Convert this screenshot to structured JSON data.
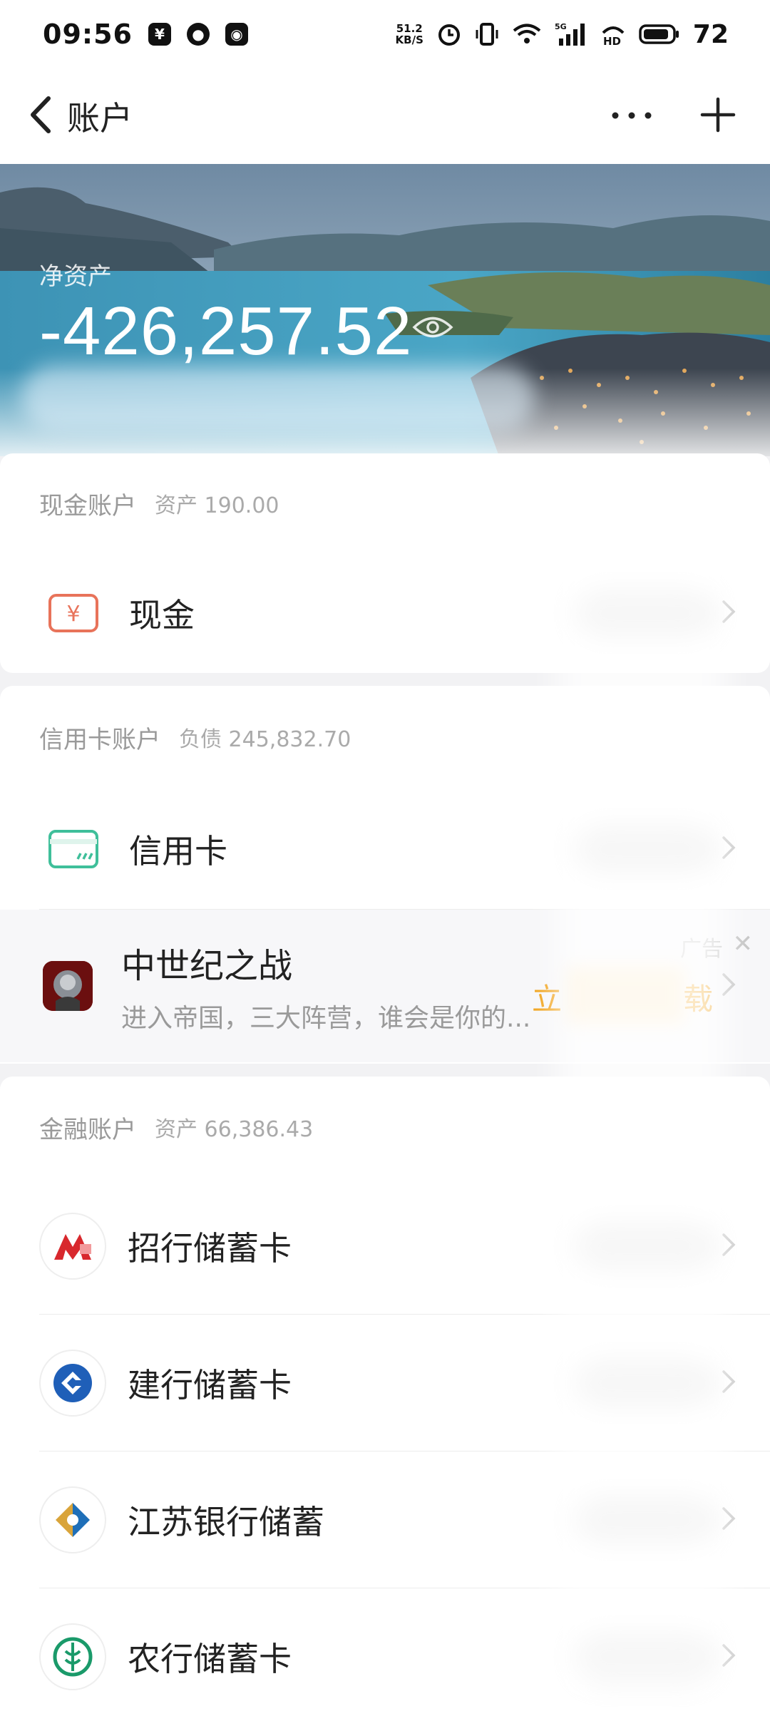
{
  "status_bar": {
    "time": "09:56",
    "net_speed_value": "51.2",
    "net_speed_unit": "KB/S",
    "battery": "72"
  },
  "header": {
    "title": "账户"
  },
  "banner": {
    "net_assets_label": "净资产",
    "net_assets_value": "-426,257.52"
  },
  "sections": {
    "cash": {
      "title": "现金账户",
      "amount": "资产 190.00",
      "items": [
        {
          "label": "现金"
        }
      ]
    },
    "credit": {
      "title": "信用卡账户",
      "amount": "负债 245,832.70",
      "items": [
        {
          "label": "信用卡"
        }
      ]
    },
    "finance": {
      "title": "金融账户",
      "amount": "资产 66,386.43",
      "items": [
        {
          "label": "招行储蓄卡"
        },
        {
          "label": "建行储蓄卡"
        },
        {
          "label": "江苏银行储蓄"
        },
        {
          "label": "农行储蓄卡"
        }
      ]
    }
  },
  "ad": {
    "title": "中世纪之战",
    "description": "进入帝国，三大阵营，谁会是你的...",
    "tag": "广告",
    "cta_left": "立",
    "cta_right": "载"
  },
  "colors": {
    "cash_icon": "#e8735a",
    "credit_icon": "#3fbf9a",
    "cmb": "#d8282d",
    "ccb": "#1f5fb8",
    "jsb": "#1f6fb8",
    "abc": "#1a9a6a",
    "cta": "#f1a31a"
  }
}
